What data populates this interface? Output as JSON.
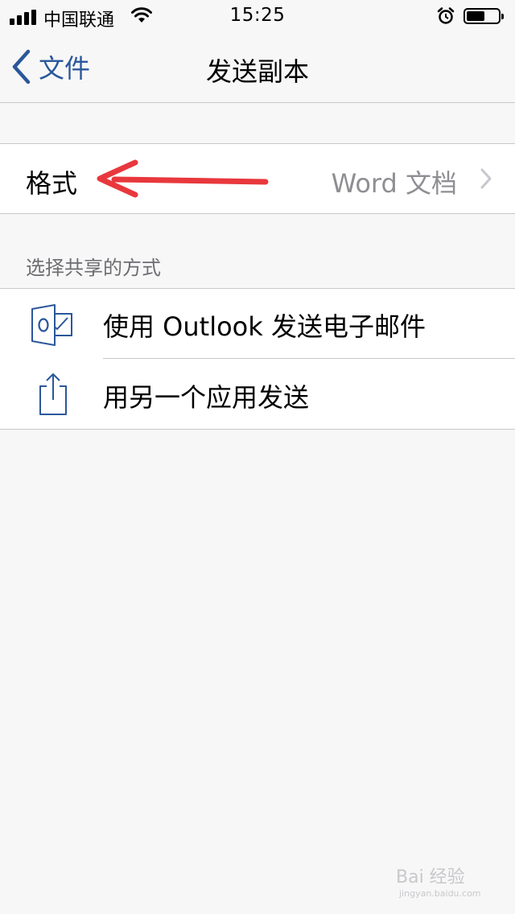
{
  "status_bar": {
    "carrier": "中国联通",
    "time": "15:25"
  },
  "nav": {
    "back_label": "文件",
    "title": "发送副本"
  },
  "format": {
    "label": "格式",
    "value": "Word 文档"
  },
  "share_section": {
    "header": "选择共享的方式",
    "items": [
      {
        "label": "使用 Outlook 发送电子邮件",
        "icon": "outlook-icon"
      },
      {
        "label": "用另一个应用发送",
        "icon": "share-icon"
      }
    ]
  },
  "annotation": {
    "arrow_color": "#e8383d"
  },
  "colors": {
    "accent": "#2b579a",
    "secondary_text": "#8e8e93",
    "background": "#f7f7f7"
  },
  "watermark": {
    "text": "Bai 经验",
    "sub": "jingyan.baidu.com"
  }
}
